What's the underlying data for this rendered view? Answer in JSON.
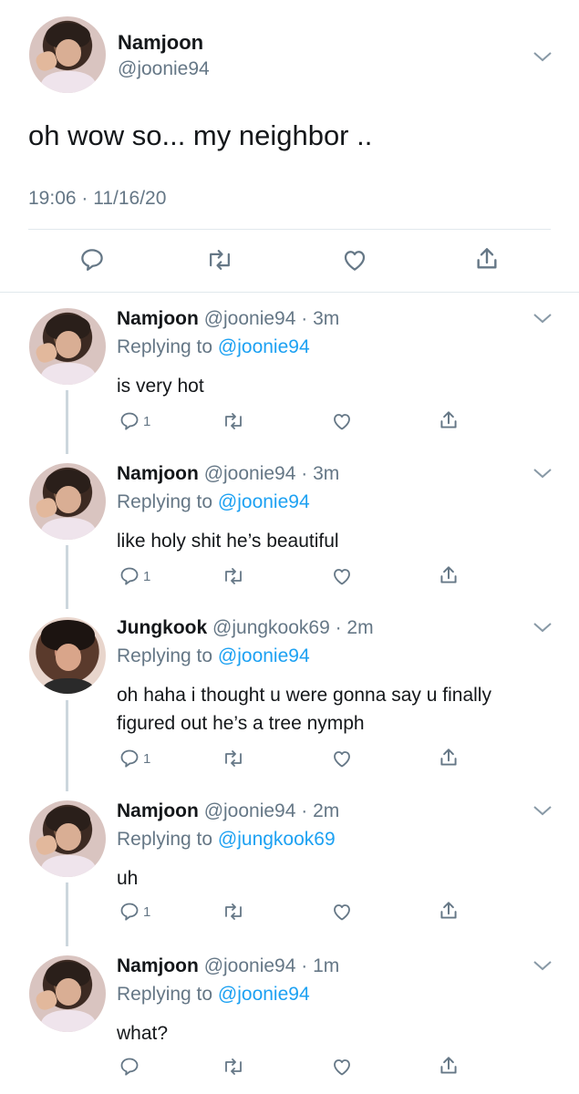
{
  "main": {
    "name": "Namjoon",
    "handle": "@joonie94",
    "text": "oh wow so... my neighbor ..",
    "timestamp": "19:06 · 11/16/20",
    "actions": [
      "reply-icon",
      "retweet-icon",
      "like-icon",
      "share-icon"
    ]
  },
  "replies": [
    {
      "name": "Namjoon",
      "meta": "@joonie94 · 3m",
      "replying_label": "Replying to",
      "replying_to": "@joonie94",
      "text": "is very hot",
      "reply_count": "1"
    },
    {
      "name": "Namjoon",
      "meta": "@joonie94 · 3m",
      "replying_label": "Replying to",
      "replying_to": "@joonie94",
      "text": "like holy shit he’s beautiful",
      "reply_count": "1"
    },
    {
      "name": "Jungkook",
      "meta": "@jungkook69 · 2m",
      "replying_label": "Replying to",
      "replying_to": "@joonie94",
      "text": "oh haha i thought u were gonna say u finally figured out he’s a tree nymph",
      "reply_count": "1"
    },
    {
      "name": "Namjoon",
      "meta": "@joonie94 · 2m",
      "replying_label": "Replying to",
      "replying_to": "@jungkook69",
      "text": "uh",
      "reply_count": "1"
    },
    {
      "name": "Namjoon",
      "meta": "@joonie94 · 1m",
      "replying_label": "Replying to",
      "replying_to": "@joonie94",
      "text": "what?",
      "reply_count": ""
    }
  ],
  "colors": {
    "link": "#1da1f2",
    "secondary": "#657786",
    "divider": "#e1e8ed",
    "thread": "#ccd6dd"
  }
}
